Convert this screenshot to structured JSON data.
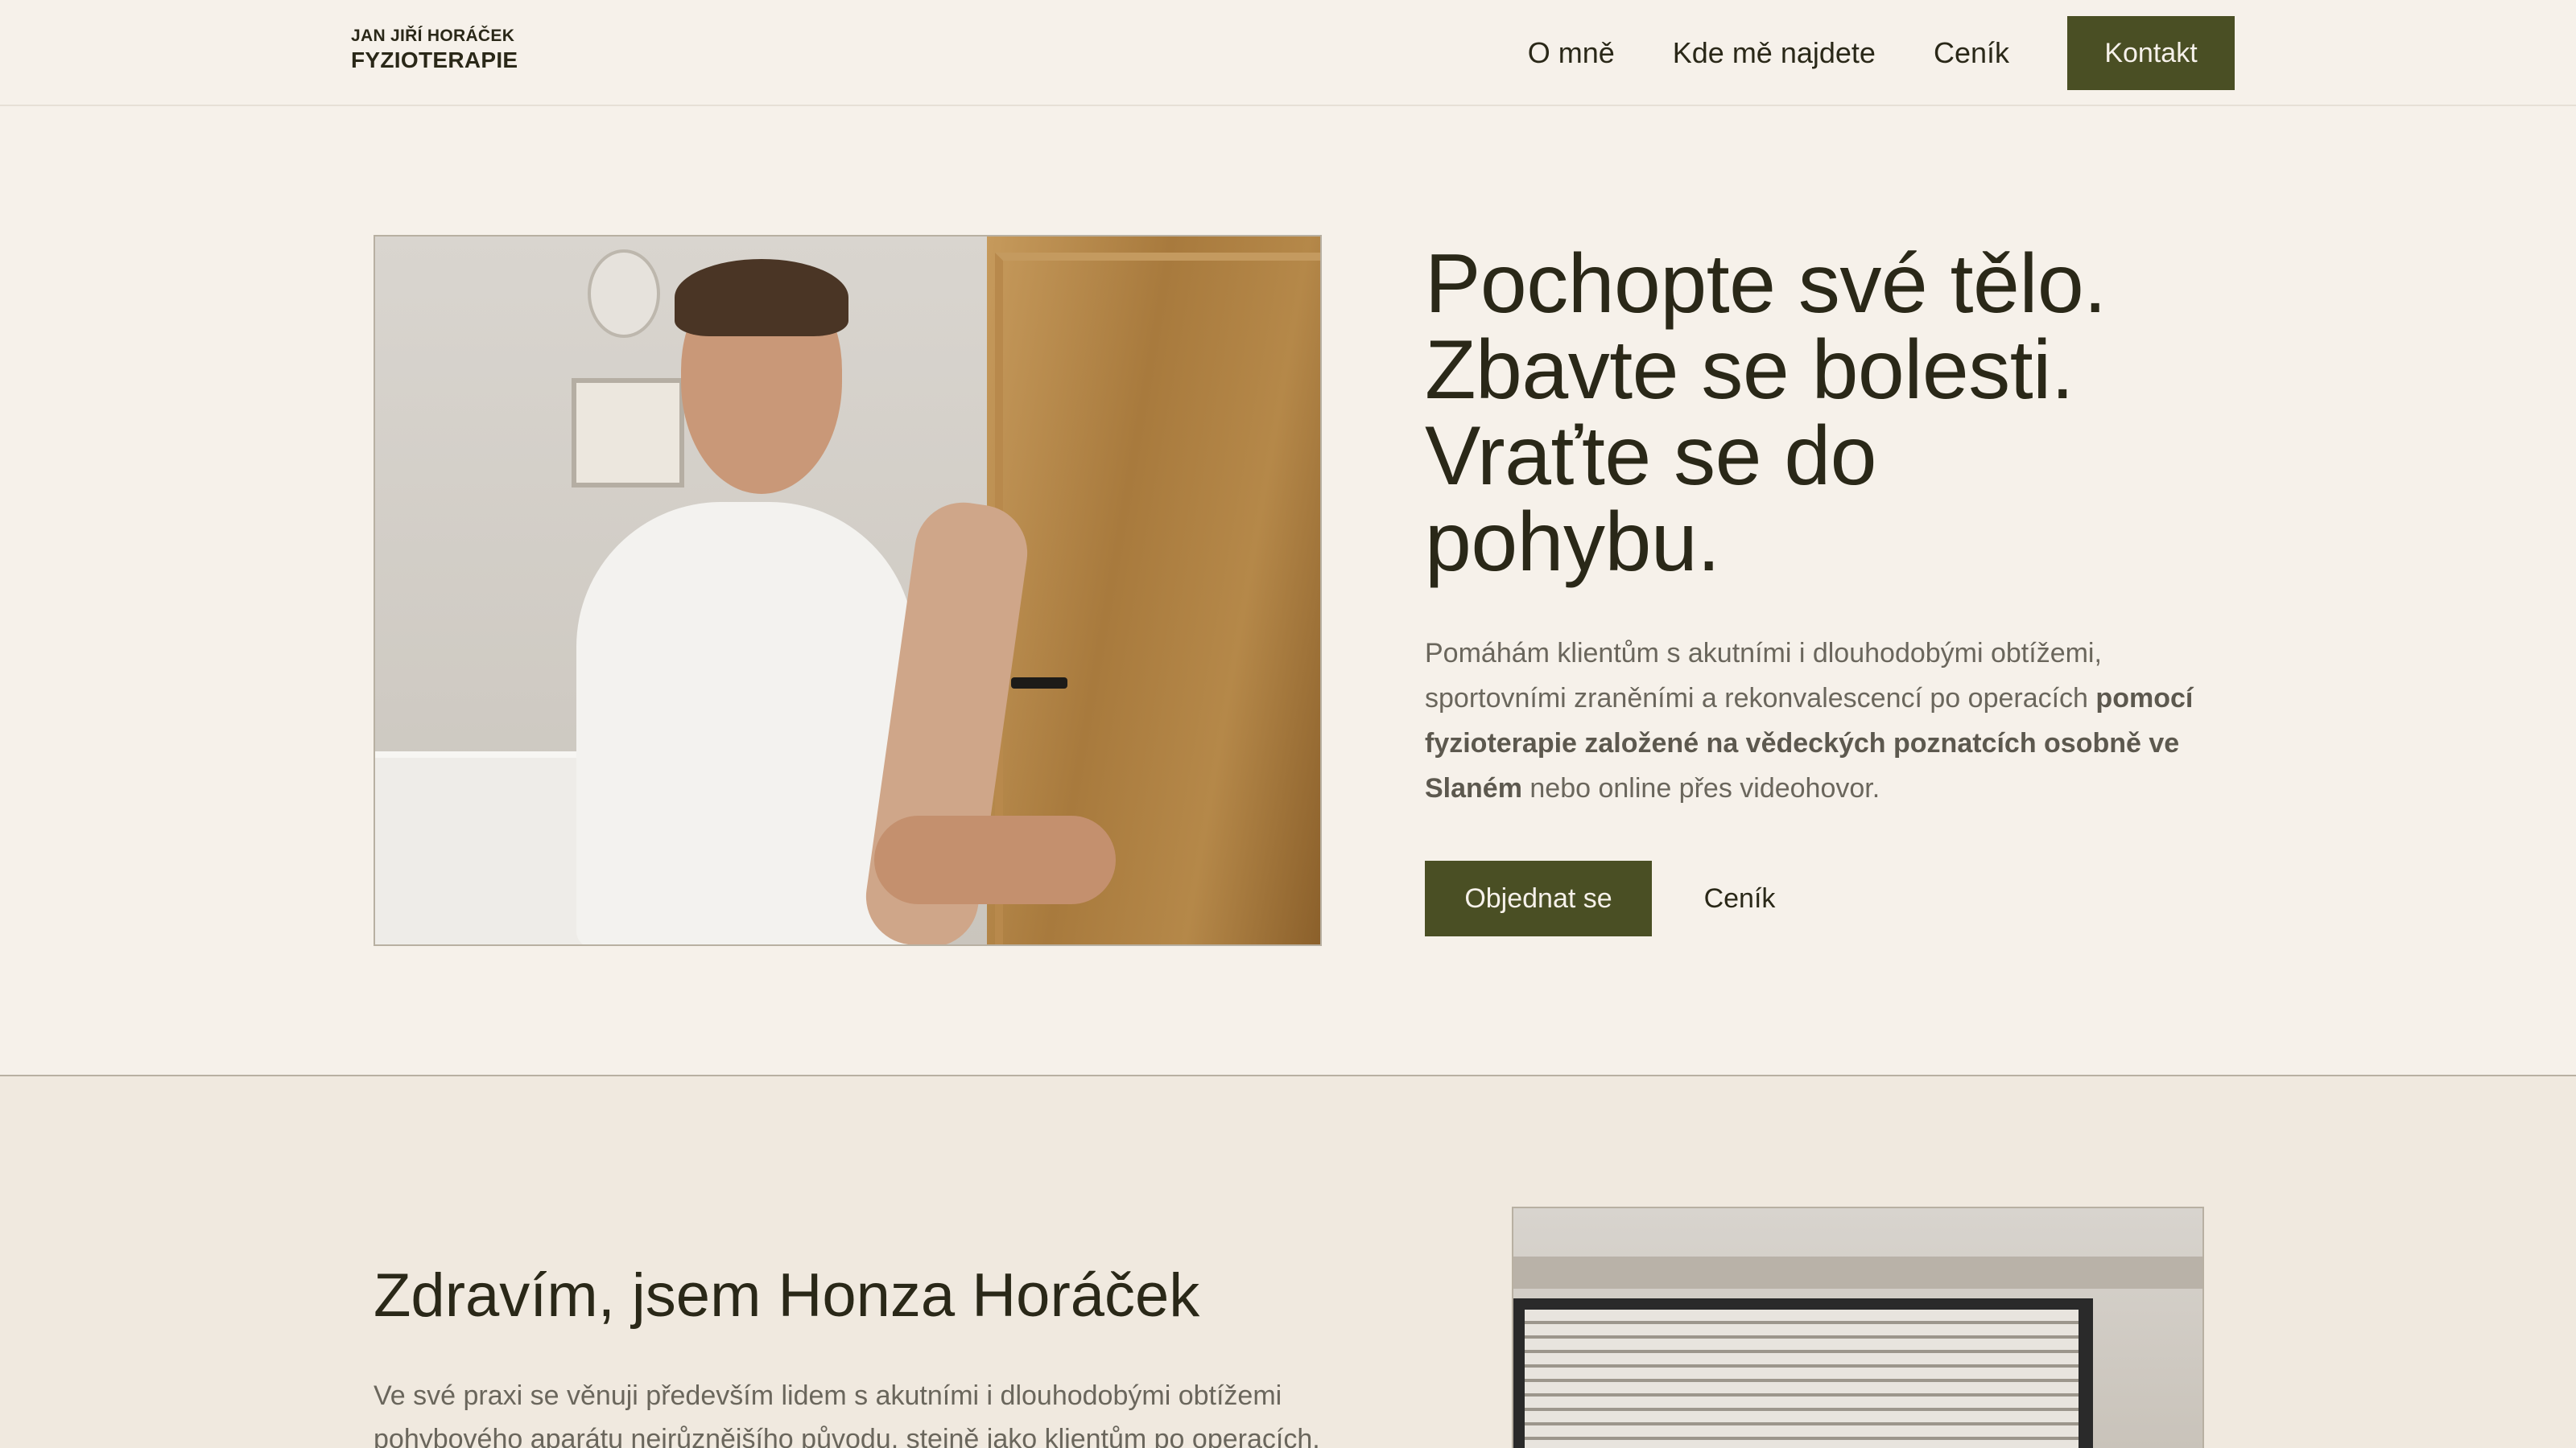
{
  "header": {
    "logo_top": "JAN JIŘÍ HORÁČEK",
    "logo_bottom": "FYZIOTERAPIE",
    "nav": [
      "O mně",
      "Kde mě najdete",
      "Ceník"
    ],
    "cta": "Kontakt"
  },
  "hero": {
    "title_lines": [
      "Pochopte své tělo.",
      "Zbavte se bolesti.",
      "Vraťte se do",
      "pohybu."
    ],
    "text_1": "Pomáhám klientům s akutními i dlouhodobými obtížemi, sportovními zraněními a rekonvalescencí po operacích ",
    "text_bold": "pomocí fyzioterapie založené na vědeckých poznatcích osobně ve Slaném",
    "text_2": " nebo online přes videohovor.",
    "primary_button": "Objednat se",
    "secondary_button": "Ceník"
  },
  "about": {
    "title": "Zdravím, jsem Honza Horáček",
    "text": "Ve své praxi se věnuji především lidem s akutními i dlouhodobými obtížemi pohybového aparátu nejrůznějšího původu, stejně jako klientům po operacích."
  },
  "colors": {
    "background": "#f6f1ea",
    "accent": "#4a4f24",
    "text": "#2a2818",
    "muted_text": "#6a665c",
    "section_background": "#f0e9df"
  }
}
